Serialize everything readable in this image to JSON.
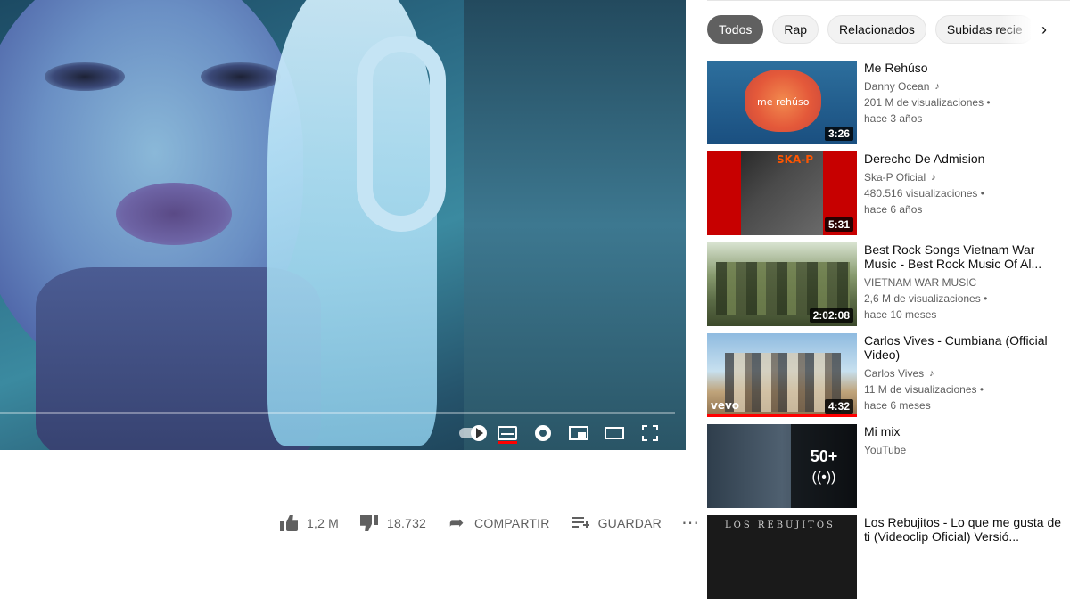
{
  "player": {
    "controls": {
      "autoplay": "autoplay-toggle",
      "subtitles": "subtitles-icon",
      "settings": "settings-gear-icon",
      "miniplayer": "miniplayer-icon",
      "theater": "theater-mode-icon",
      "fullscreen": "fullscreen-icon"
    }
  },
  "actions": {
    "like_count": "1,2 M",
    "dislike_count": "18.732",
    "share_label": "COMPARTIR",
    "save_label": "GUARDAR",
    "more": "⋯"
  },
  "chips": [
    "Todos",
    "Rap",
    "Relacionados",
    "Subidas recie"
  ],
  "chips_next": "›",
  "related": [
    {
      "title": "Me Rehúso",
      "channel": "Danny Ocean",
      "channel_icon": "music-note-icon",
      "views": "201 M de visualizaciones",
      "age": "hace 3 años",
      "duration": "3:26",
      "thumb_text": "me rehúso"
    },
    {
      "title": "Derecho De Admision",
      "channel": "Ska-P Oficial",
      "channel_icon": "music-note-icon",
      "views": "480.516 visualizaciones",
      "age": "hace 6 años",
      "duration": "5:31",
      "thumb_text": "SKA-P"
    },
    {
      "title": "Best Rock Songs Vietnam War Music - Best Rock Music Of Al...",
      "channel": "VIETNAM WAR MUSIC",
      "views": "2,6 M de visualizaciones",
      "age": "hace 10 meses",
      "duration": "2:02:08"
    },
    {
      "title": "Carlos Vives - Cumbiana (Official Video)",
      "channel": "Carlos Vives",
      "channel_icon": "music-note-icon",
      "views": "11 M de visualizaciones",
      "age": "hace 6 meses",
      "duration": "4:32",
      "thumb_text": "vevo"
    },
    {
      "title": "Mi mix",
      "channel": "YouTube",
      "playlist_count": "50+",
      "playlist_icon": "mix-radio-icon"
    },
    {
      "title": "Los Rebujitos - Lo que me gusta de ti (Videoclip Oficial) Versió...",
      "thumb_text": "LOS REBUJITOS"
    }
  ],
  "colors": {
    "chip_active_bg": "#606060",
    "duration_bg": "#000000",
    "progress_red": "#ff0000",
    "secondary_text": "#606060"
  }
}
